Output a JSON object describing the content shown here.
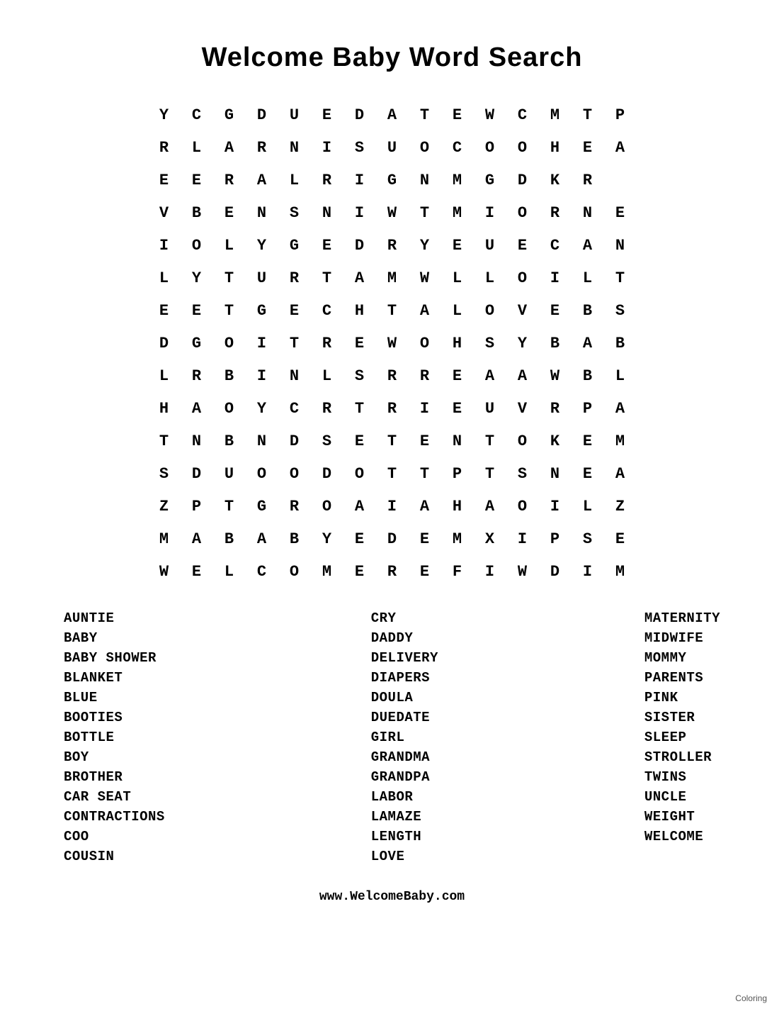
{
  "title": "Welcome Baby Word Search",
  "grid": [
    [
      "Y",
      "C",
      "G",
      "D",
      "U",
      "E",
      "D",
      "A",
      "T",
      "E",
      "W",
      "C",
      "M",
      "T",
      "P"
    ],
    [
      "R",
      "L",
      "A",
      "R",
      "N",
      "I",
      "S",
      "U",
      "O",
      "C",
      "O",
      "O",
      "H",
      "E",
      "A"
    ],
    [
      "E",
      "E",
      "R",
      "A",
      "L",
      "R",
      "I",
      "G",
      "N",
      "M",
      "G",
      "D",
      "K",
      "R",
      ""
    ],
    [
      "V",
      "B",
      "E",
      "N",
      "S",
      "N",
      "I",
      "W",
      "T",
      "M",
      "I",
      "O",
      "R",
      "N",
      "E"
    ],
    [
      "I",
      "O",
      "L",
      "Y",
      "G",
      "E",
      "D",
      "R",
      "Y",
      "E",
      "U",
      "E",
      "C",
      "A",
      "N"
    ],
    [
      "L",
      "Y",
      "T",
      "U",
      "R",
      "T",
      "A",
      "M",
      "W",
      "L",
      "L",
      "O",
      "I",
      "L",
      "T"
    ],
    [
      "E",
      "E",
      "T",
      "G",
      "E",
      "C",
      "H",
      "T",
      "A",
      "L",
      "O",
      "V",
      "E",
      "B",
      "S"
    ],
    [
      "D",
      "G",
      "O",
      "I",
      "T",
      "R",
      "E",
      "W",
      "O",
      "H",
      "S",
      "Y",
      "B",
      "A",
      "B"
    ],
    [
      "L",
      "R",
      "B",
      "I",
      "N",
      "L",
      "S",
      "R",
      "R",
      "E",
      "A",
      "A",
      "W",
      "B",
      "L"
    ],
    [
      "H",
      "A",
      "O",
      "Y",
      "C",
      "R",
      "T",
      "R",
      "I",
      "E",
      "U",
      "V",
      "R",
      "P",
      "A"
    ],
    [
      "T",
      "N",
      "B",
      "N",
      "D",
      "S",
      "E",
      "T",
      "E",
      "N",
      "T",
      "O",
      "K",
      "E",
      "M"
    ],
    [
      "S",
      "D",
      "U",
      "O",
      "O",
      "D",
      "O",
      "T",
      "T",
      "P",
      "T",
      "S",
      "N",
      "E",
      "A"
    ],
    [
      "Z",
      "P",
      "T",
      "G",
      "R",
      "O",
      "A",
      "I",
      "A",
      "H",
      "A",
      "O",
      "I",
      "L",
      "Z"
    ],
    [
      "M",
      "A",
      "B",
      "A",
      "B",
      "Y",
      "E",
      "D",
      "E",
      "M",
      "X",
      "I",
      "P",
      "S",
      "E"
    ],
    [
      "W",
      "E",
      "L",
      "C",
      "O",
      "M",
      "E",
      "R",
      "E",
      "F",
      "I",
      "W",
      "D",
      "I",
      "M"
    ]
  ],
  "word_columns": [
    {
      "id": "col1",
      "words": [
        "AUNTIE",
        "BABY",
        "BABY SHOWER",
        "BLANKET",
        "BLUE",
        "BOOTIES",
        "BOTTLE",
        "BOY",
        "BROTHER",
        "CAR SEAT",
        "CONTRACTIONS",
        "COO",
        "COUSIN"
      ]
    },
    {
      "id": "col2",
      "words": [
        "CRY",
        "DADDY",
        "DELIVERY",
        "DIAPERS",
        "DOULA",
        "DUEDATE",
        "GIRL",
        "GRANDMA",
        "GRANDPA",
        "LABOR",
        "LAMAZE",
        "LENGTH",
        "LOVE"
      ]
    },
    {
      "id": "col3",
      "words": [
        "MATERNITY",
        "MIDWIFE",
        "MOMMY",
        "PARENTS",
        "PINK",
        "SISTER",
        "SLEEP",
        "STROLLER",
        "TWINS",
        "UNCLE",
        "WEIGHT",
        "WELCOME"
      ]
    }
  ],
  "website": "www.WelcomeBaby.com",
  "coloring_label": "Coloring"
}
